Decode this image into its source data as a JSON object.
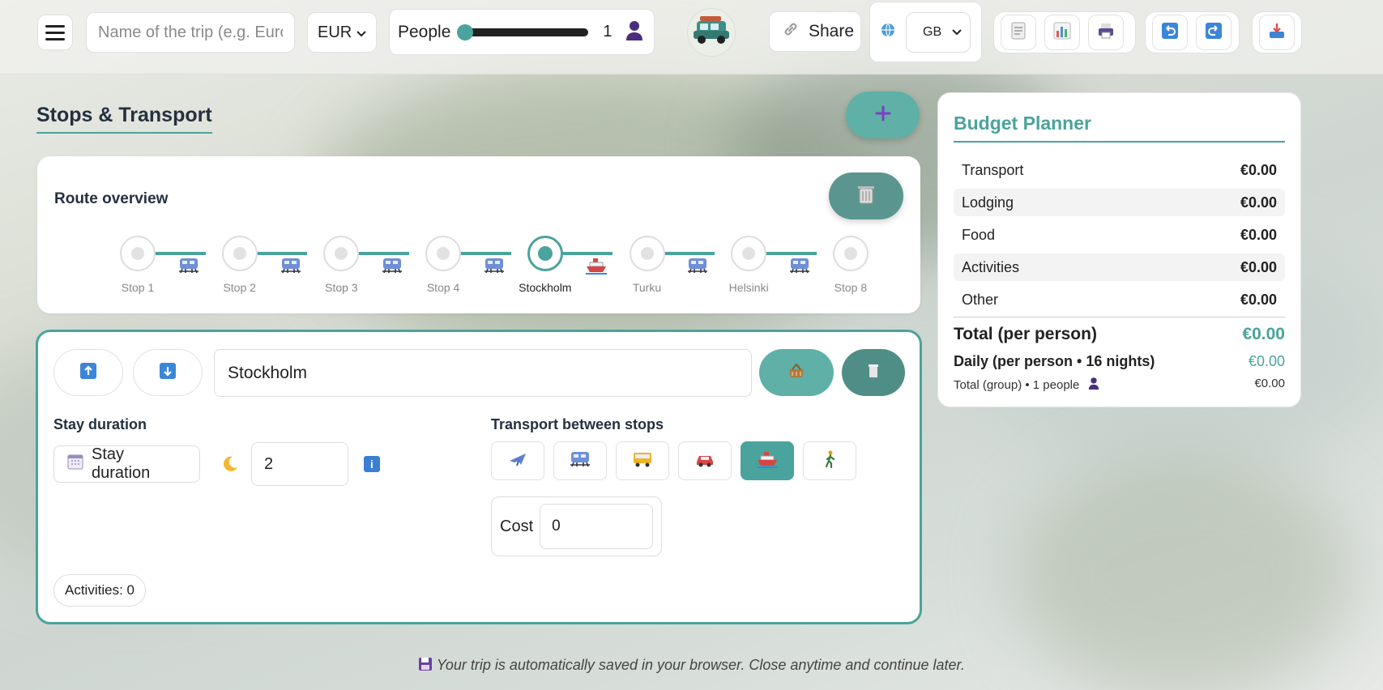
{
  "header": {
    "trip_name_placeholder": "Name of the trip (e.g. Europe 2025)",
    "currency": "EUR",
    "people_label": "People",
    "people_count": "1",
    "people_slider_fraction": 0.0,
    "share_label": "Share",
    "language": "GB",
    "icons": [
      "menu-icon",
      "chevron-down-icon",
      "person-icon",
      "car-logo-icon",
      "link-icon",
      "globe-icon",
      "document-icon",
      "chart-icon",
      "printer-icon",
      "undo-icon",
      "redo-icon",
      "download-icon"
    ]
  },
  "section": {
    "title": "Stops & Transport"
  },
  "route": {
    "title": "Route overview",
    "stops": [
      "Stop 1",
      "Stop 2",
      "Stop 3",
      "Stop 4",
      "Stockholm",
      "Turku",
      "Helsinki",
      "Stop 8"
    ],
    "active_stop": "Stockholm",
    "transports": [
      "train",
      "train",
      "train",
      "train",
      "ship",
      "train",
      "train"
    ]
  },
  "stop_editor": {
    "city": "Stockholm",
    "stay_label": "Stay duration",
    "stay_button": "Stay duration",
    "nights": "2",
    "transport_label": "Transport between stops",
    "modes": [
      "plane",
      "train",
      "bus",
      "car",
      "ship",
      "walk"
    ],
    "active_mode": "ship",
    "cost_label": "Cost",
    "cost_value": "0",
    "activities": "Activities: 0"
  },
  "budget": {
    "title": "Budget Planner",
    "rows": [
      {
        "label": "Transport",
        "amount": "€0.00"
      },
      {
        "label": "Lodging",
        "amount": "€0.00"
      },
      {
        "label": "Food",
        "amount": "€0.00"
      },
      {
        "label": "Activities",
        "amount": "€0.00"
      },
      {
        "label": "Other",
        "amount": "€0.00"
      }
    ],
    "total_label": "Total (per person)",
    "total_amount": "€0.00",
    "daily_label": "Daily (per person • 16 nights)",
    "daily_amount": "€0.00",
    "group_label": "Total (group) • 1 people",
    "group_amount": "€0.00"
  },
  "footer": {
    "note": "Your trip is automatically saved in your browser. Close anytime and continue later."
  },
  "colors": {
    "accent": "#4aa39c",
    "accent_dark": "#5a968f",
    "title": "#253040"
  }
}
